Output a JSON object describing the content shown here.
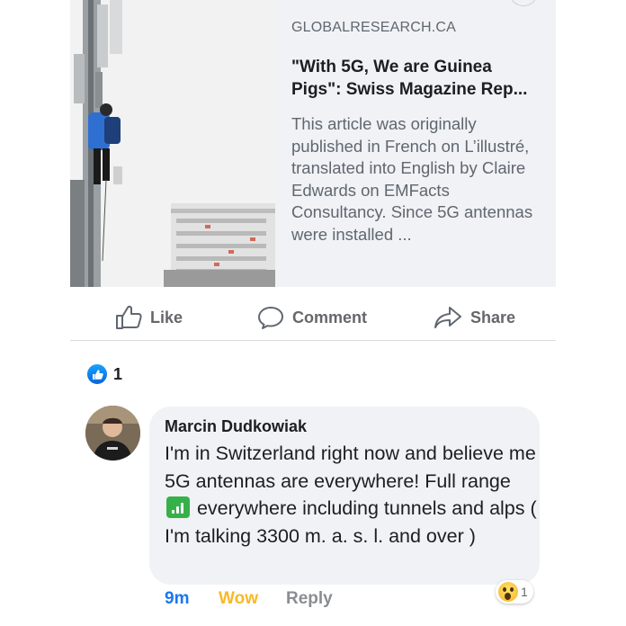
{
  "link_preview": {
    "domain": "GLOBALRESEARCH.CA",
    "title": "\"With 5G, We are Guinea Pigs\": Swiss Magazine Rep...",
    "description": "This article was originally published in French on L’illustré, translated into English by Claire Edwards on EMFacts Consultancy. Since 5G antennas were installed ..."
  },
  "actions": {
    "like": "Like",
    "comment": "Comment",
    "share": "Share"
  },
  "reactions": {
    "count": "1"
  },
  "comment": {
    "author": "Marcin Dudkowiak",
    "text_before_emoji": "I'm in Switzerland right now and believe me 5G antennas are everywhere! Full range ",
    "text_after_emoji": " everywhere including tunnels and alps ( I'm talking  3300 m. a. s. l. and over )",
    "emoji": "signal-bars-icon",
    "time": "9m",
    "wow": "Wow",
    "reply": "Reply",
    "reaction_count": "1"
  },
  "colors": {
    "accent": "#1877f2",
    "wow": "#f7b928",
    "muted": "#65676b",
    "bubble": "#f0f2f5"
  }
}
